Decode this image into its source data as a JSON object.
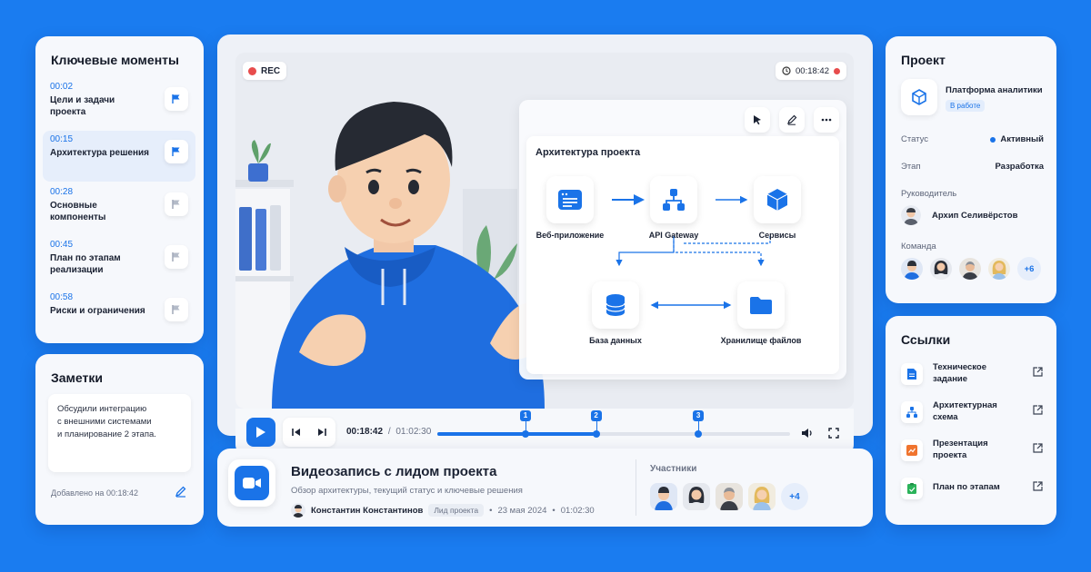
{
  "moments": {
    "title": "Ключевые моменты",
    "items": [
      {
        "time": "00:02",
        "label": "Цели и задачи проекта"
      },
      {
        "time": "00:15",
        "label": "Архитектура решения"
      },
      {
        "time": "00:28",
        "label": "Основные компоненты"
      },
      {
        "time": "00:45",
        "label": "План по этапам реализации"
      },
      {
        "time": "00:58",
        "label": "Риски и ограничения"
      }
    ]
  },
  "notes": {
    "title": "Заметки",
    "text_lines": [
      "Обсудили интеграцию",
      "с внешними системами",
      "и планирование 2 этапа."
    ],
    "added": "Добавлено на 00:18:42"
  },
  "player": {
    "rec_label": "REC",
    "timer": "00:18:42",
    "current_time": "00:18:42",
    "separator": "/",
    "total_time": "01:02:30",
    "progress": 0.46,
    "markers": [
      "1",
      "2",
      "3"
    ],
    "diagram": {
      "title": "Архитектура проекта",
      "nodes": {
        "web": "Веб-приложение",
        "api": "API Gateway",
        "services": "Сервисы",
        "db": "База данных",
        "storage": "Хранилище файлов"
      }
    }
  },
  "info": {
    "title": "Видеозапись с лидом проекта",
    "subtitle": "Обзор архитектуры, текущий статус и ключевые решения",
    "author": "Константин Константинов",
    "role": "Лид проекта",
    "date": "23 мая 2024",
    "duration": "01:02:30",
    "dot": "•",
    "participants_title": "Участники",
    "participants_more": "+4"
  },
  "project": {
    "title": "Проект",
    "name": "Платформа аналитики",
    "badge": "В работе",
    "status_label": "Статус",
    "status_value": "Активный",
    "stage_label": "Этап",
    "stage_value": "Разработка",
    "lead_label": "Руководитель",
    "lead_name": "Архип Селивёрстов",
    "team_label": "Команда",
    "team_more": "+6"
  },
  "links": {
    "title": "Ссылки",
    "items": [
      {
        "label": "Техническое задание"
      },
      {
        "label": "Архитектурная схема"
      },
      {
        "label": "Презентация проекта"
      },
      {
        "label": "План по этапам"
      }
    ]
  },
  "colors": {
    "accent": "#1a73e8",
    "background": "#1a7cf0",
    "rec": "#e74c4c"
  }
}
